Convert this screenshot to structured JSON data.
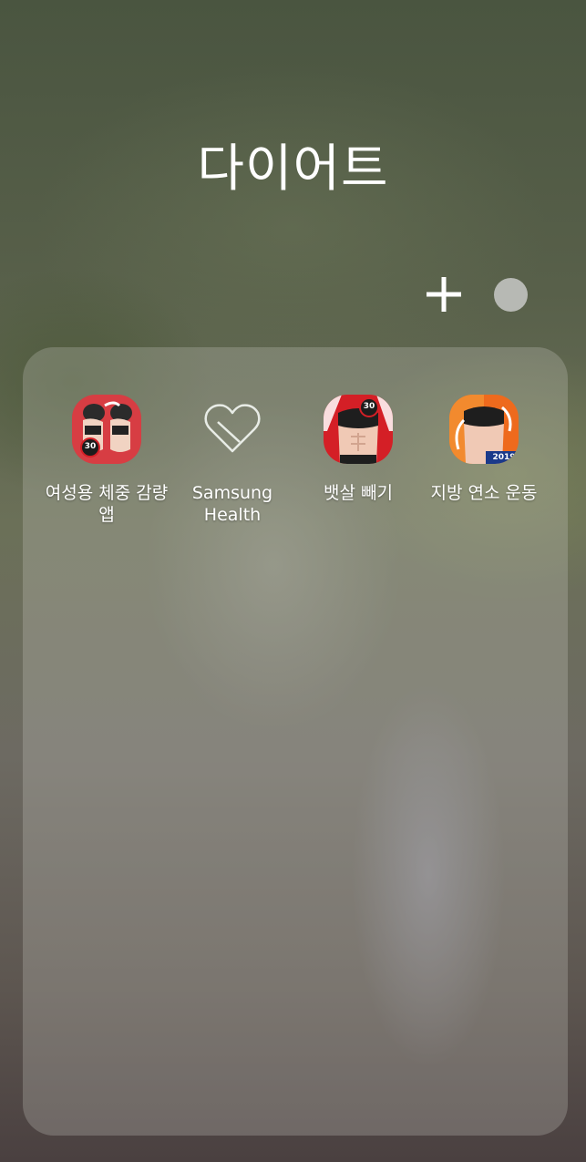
{
  "folder": {
    "title": "다이어트"
  },
  "apps": [
    {
      "label": "여성용 체중 감량 앱",
      "icon": "women-weight-loss-icon"
    },
    {
      "label": "Samsung Health",
      "icon": "samsung-health-heart-icon"
    },
    {
      "label": "뱃살 빼기",
      "icon": "belly-fat-workout-icon"
    },
    {
      "label": "지방 연소 운동",
      "icon": "fat-burning-workout-icon"
    }
  ],
  "badges": {
    "app1": "30",
    "app3": "30",
    "app4": "2019"
  },
  "controls": {
    "add_icon": "plus-icon",
    "color_icon": "folder-color-icon"
  },
  "colors": {
    "accent_red": "#d41f26",
    "accent_orange": "#ee6a1d",
    "text": "#ffffff"
  }
}
